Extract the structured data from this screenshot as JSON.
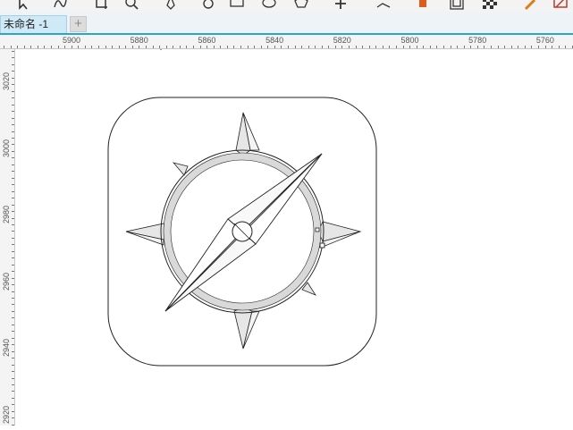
{
  "document_tab": {
    "title": "未命名 -1",
    "add_label": "+"
  },
  "ruler": {
    "horizontal_labels": [
      "5900",
      "5880",
      "5860",
      "5840",
      "5820",
      "5800",
      "5780",
      "5760"
    ],
    "vertical_labels": [
      "3020",
      "3000",
      "2980",
      "2960",
      "2940",
      "2920"
    ]
  },
  "colors": {
    "accent": "#2aa6c9",
    "tab_active": "#cfe9f7",
    "ruler_bg": "#f4f4f4",
    "ring_fill": "#d9d9d9",
    "needle_fill": "#ebebeb"
  },
  "toolbar_icons": [
    "select-icon",
    "freehand-icon",
    "crop-icon",
    "zoom-icon",
    "pen-icon",
    "spiral-icon",
    "rectangle-icon",
    "ellipse-icon",
    "polygon-icon",
    "text-icon",
    "connector-icon",
    "fill-icon",
    "contour-icon",
    "transparency-icon",
    "eyedropper-icon",
    "eraser-icon"
  ]
}
